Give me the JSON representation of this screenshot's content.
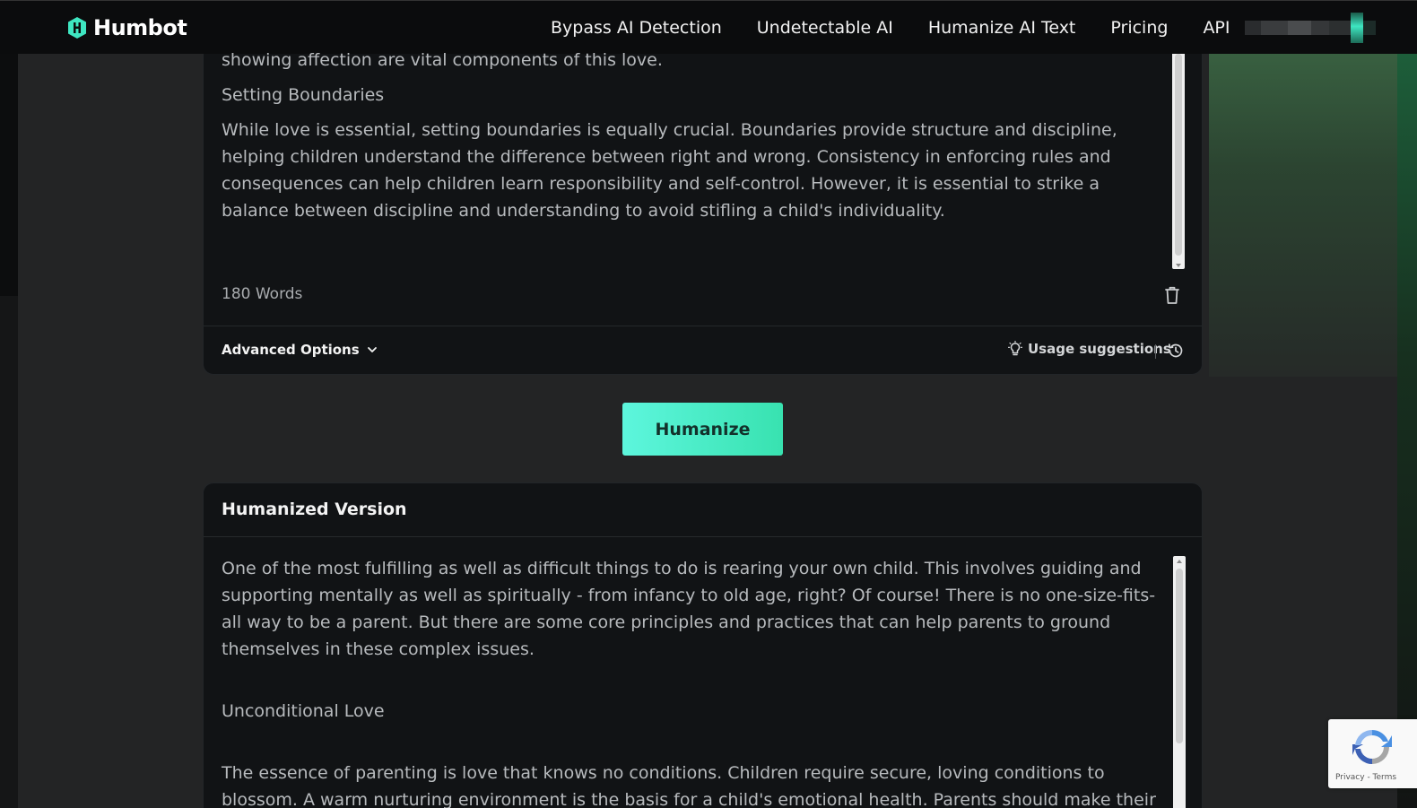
{
  "brand": {
    "name": "Humbot",
    "accent": "#3ee6c1"
  },
  "nav": {
    "links": [
      "Bypass AI Detection",
      "Undetectable AI",
      "Humanize AI Text",
      "Pricing",
      "API"
    ]
  },
  "input": {
    "partial_line": "showing affection are vital components of this love.",
    "heading": "Setting Boundaries",
    "paragraph": "While love is essential, setting boundaries is equally crucial. Boundaries provide structure and discipline, helping children understand the difference between right and wrong. Consistency in enforcing rules and consequences can help children learn responsibility and self-control. However, it is essential to strike a balance between discipline and understanding to avoid stifling a child's individuality.",
    "word_count": "180 Words",
    "advanced_options_label": "Advanced Options",
    "usage_suggestions_label": "Usage suggestions"
  },
  "humanize_button": {
    "label": "Humanize",
    "gradient_start": "#5df6dd",
    "gradient_end": "#38e2b0"
  },
  "output": {
    "title": "Humanized Version",
    "paragraph1": "One of the most fulfilling as well as difficult things to do is rearing your own child. This involves guiding and supporting mentally as well as spiritually - from infancy to old age, right? Of course! There is no one-size-fits-all way to be a parent. But there are some core principles and practices that can help parents to ground themselves in these complex issues.",
    "heading": "Unconditional Love",
    "paragraph2": "The essence of parenting is love that knows no conditions. Children require secure, loving conditions to blossom. A warm nurturing environment is the basis for a child's emotional health. Parents should make their feelings"
  },
  "recaptcha": {
    "links": "Privacy - Terms"
  },
  "icons": {
    "trash": "trash-icon",
    "chevron": "chevron-down-icon",
    "bulb": "lightbulb-icon",
    "history": "history-icon",
    "logo": "humbot-logo-icon",
    "recaptcha": "recaptcha-icon"
  }
}
